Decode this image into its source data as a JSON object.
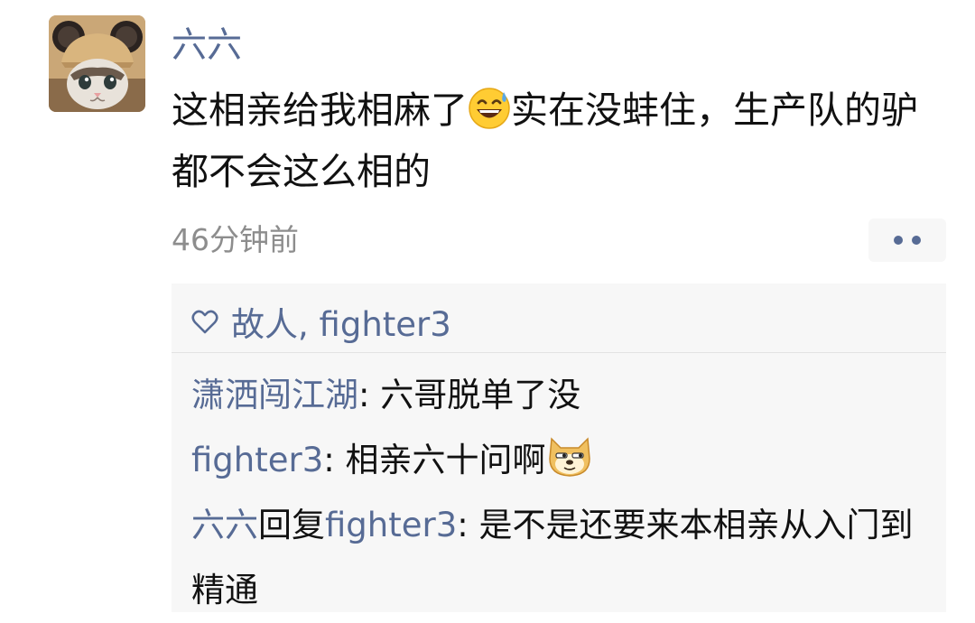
{
  "post": {
    "author": "六六",
    "text_part1": "这相亲给我相麻了",
    "emoji_1": "grinning-sweat-emoji",
    "text_part2": "实在没蚌住，生产队的驴都不会这么相的",
    "time": "46分钟前"
  },
  "likes": {
    "icon": "heart-outline-icon",
    "names": "故人, fighter3"
  },
  "comments": [
    {
      "author": "潇洒闯江湖",
      "separator": ": ",
      "text": "六哥脱单了没"
    },
    {
      "author": "fighter3",
      "separator": ": ",
      "text": "相亲六十问啊",
      "emoji": "doge-emoji"
    },
    {
      "author": "六六",
      "reply_word": "回复",
      "reply_to": "fighter3",
      "separator": ": ",
      "text": "是不是还要来本相亲从入门到精通"
    }
  ],
  "colors": {
    "link_blue": "#576b95",
    "time_gray": "#8d8d8d",
    "panel_bg": "#f7f7f7"
  }
}
